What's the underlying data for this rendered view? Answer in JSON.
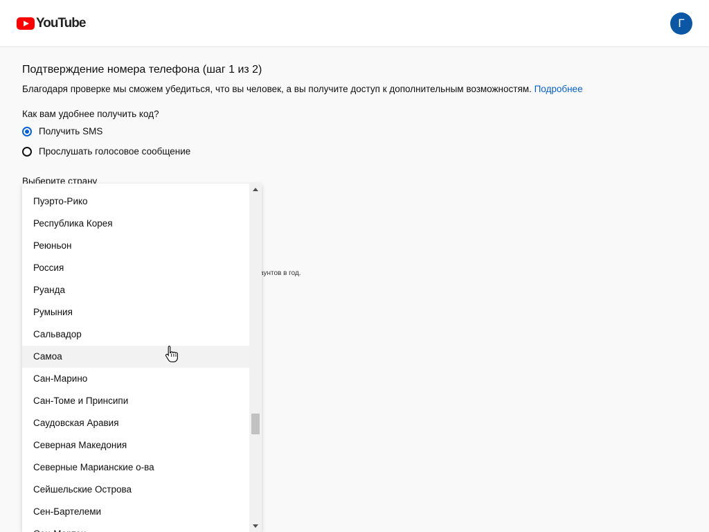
{
  "header": {
    "logo_text": "YouTube",
    "avatar_letter": "Г"
  },
  "verification": {
    "title": "Подтверждение номера телефона (шаг 1 из 2)",
    "description": "Благодаря проверке мы сможем убедиться, что вы человек, а вы получите доступ к дополнительным возможностям.",
    "learn_more": "Подробнее",
    "question": "Как вам удобнее получить код?",
    "options": [
      {
        "label": "Получить SMS",
        "checked": true
      },
      {
        "label": "Прослушать голосовое сообщение",
        "checked": false
      }
    ],
    "country_label": "Выберите страну",
    "hidden_note_fragment": "аунтов в год."
  },
  "country_dropdown": {
    "items": [
      "Пуэрто-Рико",
      "Республика Корея",
      "Реюньон",
      "Россия",
      "Руанда",
      "Румыния",
      "Сальвадор",
      "Самоа",
      "Сан-Марино",
      "Сан-Томе и Принсипи",
      "Саудовская Аравия",
      "Северная Македония",
      "Северные Марианские о-ва",
      "Сейшельские Острова",
      "Сен-Бартелеми",
      "Сен-Мартен"
    ],
    "hovered_item": "Самоа"
  },
  "colors": {
    "brand_red": "#ff0000",
    "link_blue": "#065fd4",
    "avatar_blue": "#0b57a6"
  }
}
